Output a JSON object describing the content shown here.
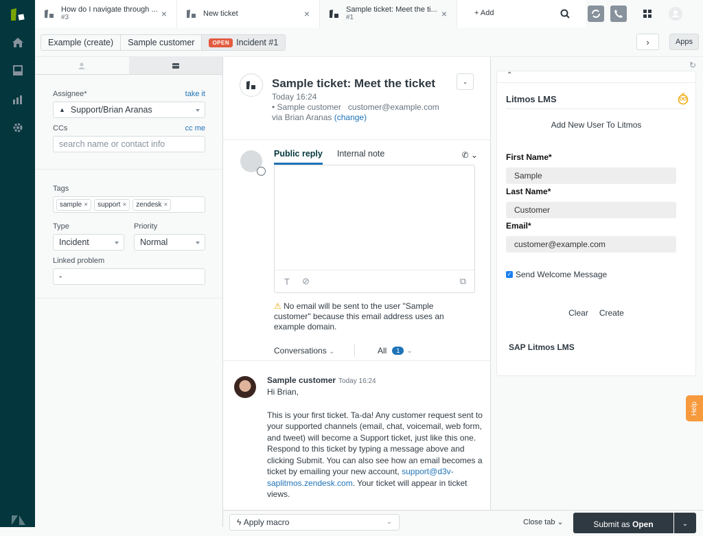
{
  "tabs": [
    {
      "title": "How do I navigate through ...",
      "sub": "#3"
    },
    {
      "title": "New ticket",
      "sub": ""
    },
    {
      "title": "Sample ticket: Meet the ti...",
      "sub": "#1"
    }
  ],
  "add_label": "+ Add",
  "breadcrumbs": [
    "Example (create)",
    "Sample customer"
  ],
  "status_badge": "OPEN",
  "incident_label": "Incident #1",
  "apps_label": "Apps",
  "fields": {
    "assignee_label": "Assignee*",
    "take_it": "take it",
    "assignee_value": "Support/Brian Aranas",
    "ccs_label": "CCs",
    "cc_me": "cc me",
    "ccs_placeholder": "search name or contact info",
    "tags_label": "Tags",
    "tags": [
      "sample",
      "support",
      "zendesk"
    ],
    "type_label": "Type",
    "type_value": "Incident",
    "priority_label": "Priority",
    "priority_value": "Normal",
    "linked_label": "Linked problem",
    "linked_value": "-"
  },
  "ticket": {
    "title": "Sample ticket: Meet the ticket",
    "time": "Today 16:24",
    "requester": "• Sample customer   customer@example.com",
    "via": "via Brian Aranas",
    "change": "(change)"
  },
  "reply": {
    "public": "Public reply",
    "internal": "Internal note",
    "warning": "No email will be sent to the user \"Sample customer\" because this email address uses an example domain."
  },
  "conversations": {
    "label": "Conversations",
    "filter": "All",
    "count": "1"
  },
  "message": {
    "author": "Sample customer",
    "time": "Today 16:24",
    "greeting": "Hi Brian,",
    "body": "This is your first ticket. Ta-da! Any customer request sent to your supported channels (email, chat, voicemail, web form, and tweet) will become a Support ticket, just like this one. Respond to this ticket by typing a message above and clicking Submit. You can also see how an email becomes a ticket by emailing your new account, ",
    "link": "support@d3v-saplitmos.zendesk.com",
    "tail": ". Your ticket will appear in ticket views."
  },
  "app": {
    "title": "Litmos LMS",
    "subtitle": "Add New User To Litmos",
    "first_label": "First Name*",
    "first_value": "Sample",
    "last_label": "Last Name*",
    "last_value": "Customer",
    "email_label": "Email*",
    "email_value": "customer@example.com",
    "welcome": "Send Welcome Message",
    "clear": "Clear",
    "create": "Create",
    "footer": "SAP Litmos LMS"
  },
  "help": "Help",
  "bottom": {
    "macro": "Apply macro",
    "close_tab": "Close tab ⌄",
    "submit_prefix": "Submit as ",
    "submit_status": "Open"
  }
}
